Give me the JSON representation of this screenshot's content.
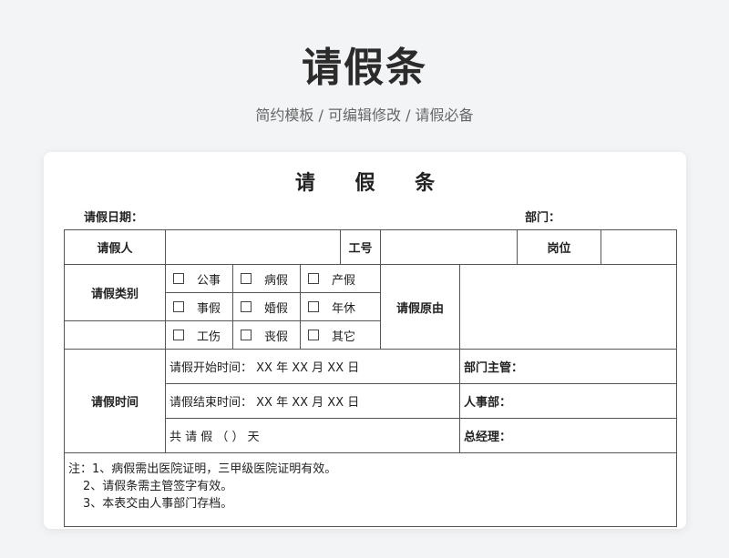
{
  "hero": {
    "title": "请假条",
    "subtitle": "简约模板 /  可编辑修改  / 请假必备"
  },
  "form": {
    "title": "请 假 条",
    "date_label": "请假日期：",
    "dept_label": "部门：",
    "applicant_label": "请假人",
    "employee_id_label": "工号",
    "position_label": "岗位",
    "type_label": "请假类别",
    "leave_types": [
      [
        "公事",
        "病假",
        "产假"
      ],
      [
        "事假",
        "婚假",
        "年休"
      ],
      [
        "工伤",
        "丧假",
        "其它"
      ]
    ],
    "reason_label": "请假原由",
    "time_label": "请假时间",
    "start_time": "请假开始时间：  XX 年 XX 月 XX 日",
    "end_time": "请假结束时间：  XX 年 XX 月 XX 日",
    "total_days": "共 请 假 （  ） 天",
    "dept_manager_label": "部门主管：",
    "hr_label": "人事部：",
    "gm_label": "总经理：",
    "notes": [
      "注：1、病假需出医院证明，三甲级医院证明有效。",
      "2、请假条需主管签字有效。",
      "3、本表交由人事部门存档。"
    ]
  }
}
